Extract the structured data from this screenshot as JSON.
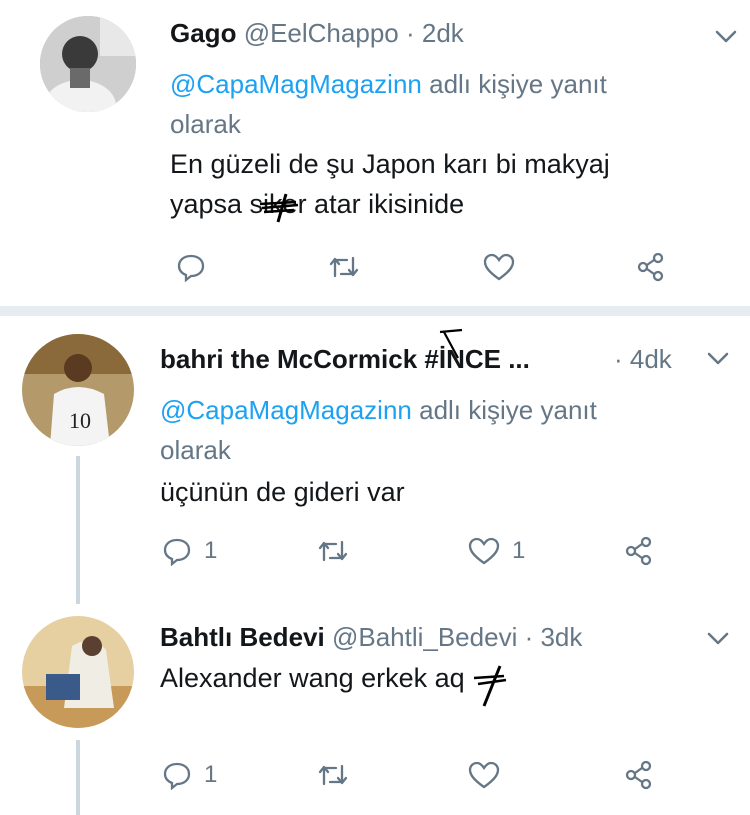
{
  "tweets": [
    {
      "name": "Gago",
      "handle": "@EelChappo",
      "time": "· 2dk",
      "reply_to": "@CapaMagMagazinn",
      "reply_suffix": "adlı kişiye yanıt",
      "reply_suffix2": "olarak",
      "line1": "En güzeli de şu Japon karı bi makyaj",
      "line2": "yapsa siker atar ikisinide",
      "reply_count": "",
      "retweet_count": "",
      "like_count": ""
    },
    {
      "name": "bahri the McCormick #İNCE ...",
      "handle": "",
      "time": "· 4dk",
      "reply_to": "@CapaMagMagazinn",
      "reply_suffix": "adlı kişiye yanıt",
      "reply_suffix2": "olarak",
      "line1": "üçünün de gideri var",
      "reply_count": "1",
      "retweet_count": "",
      "like_count": "1"
    },
    {
      "name": "Bahtlı Bedevi",
      "handle": "@Bahtli_Bedevi",
      "time": "· 3dk",
      "line1": "Alexander wang erkek aq",
      "reply_count": "1",
      "retweet_count": "",
      "like_count": ""
    }
  ],
  "colors": {
    "link": "#1da1f2",
    "muted": "#657786",
    "text": "#14171a",
    "divider": "#e6ecf0",
    "thread": "#ccd6dd"
  },
  "icons": [
    "reply-icon",
    "retweet-icon",
    "like-icon",
    "share-icon",
    "chevron-down-icon"
  ]
}
